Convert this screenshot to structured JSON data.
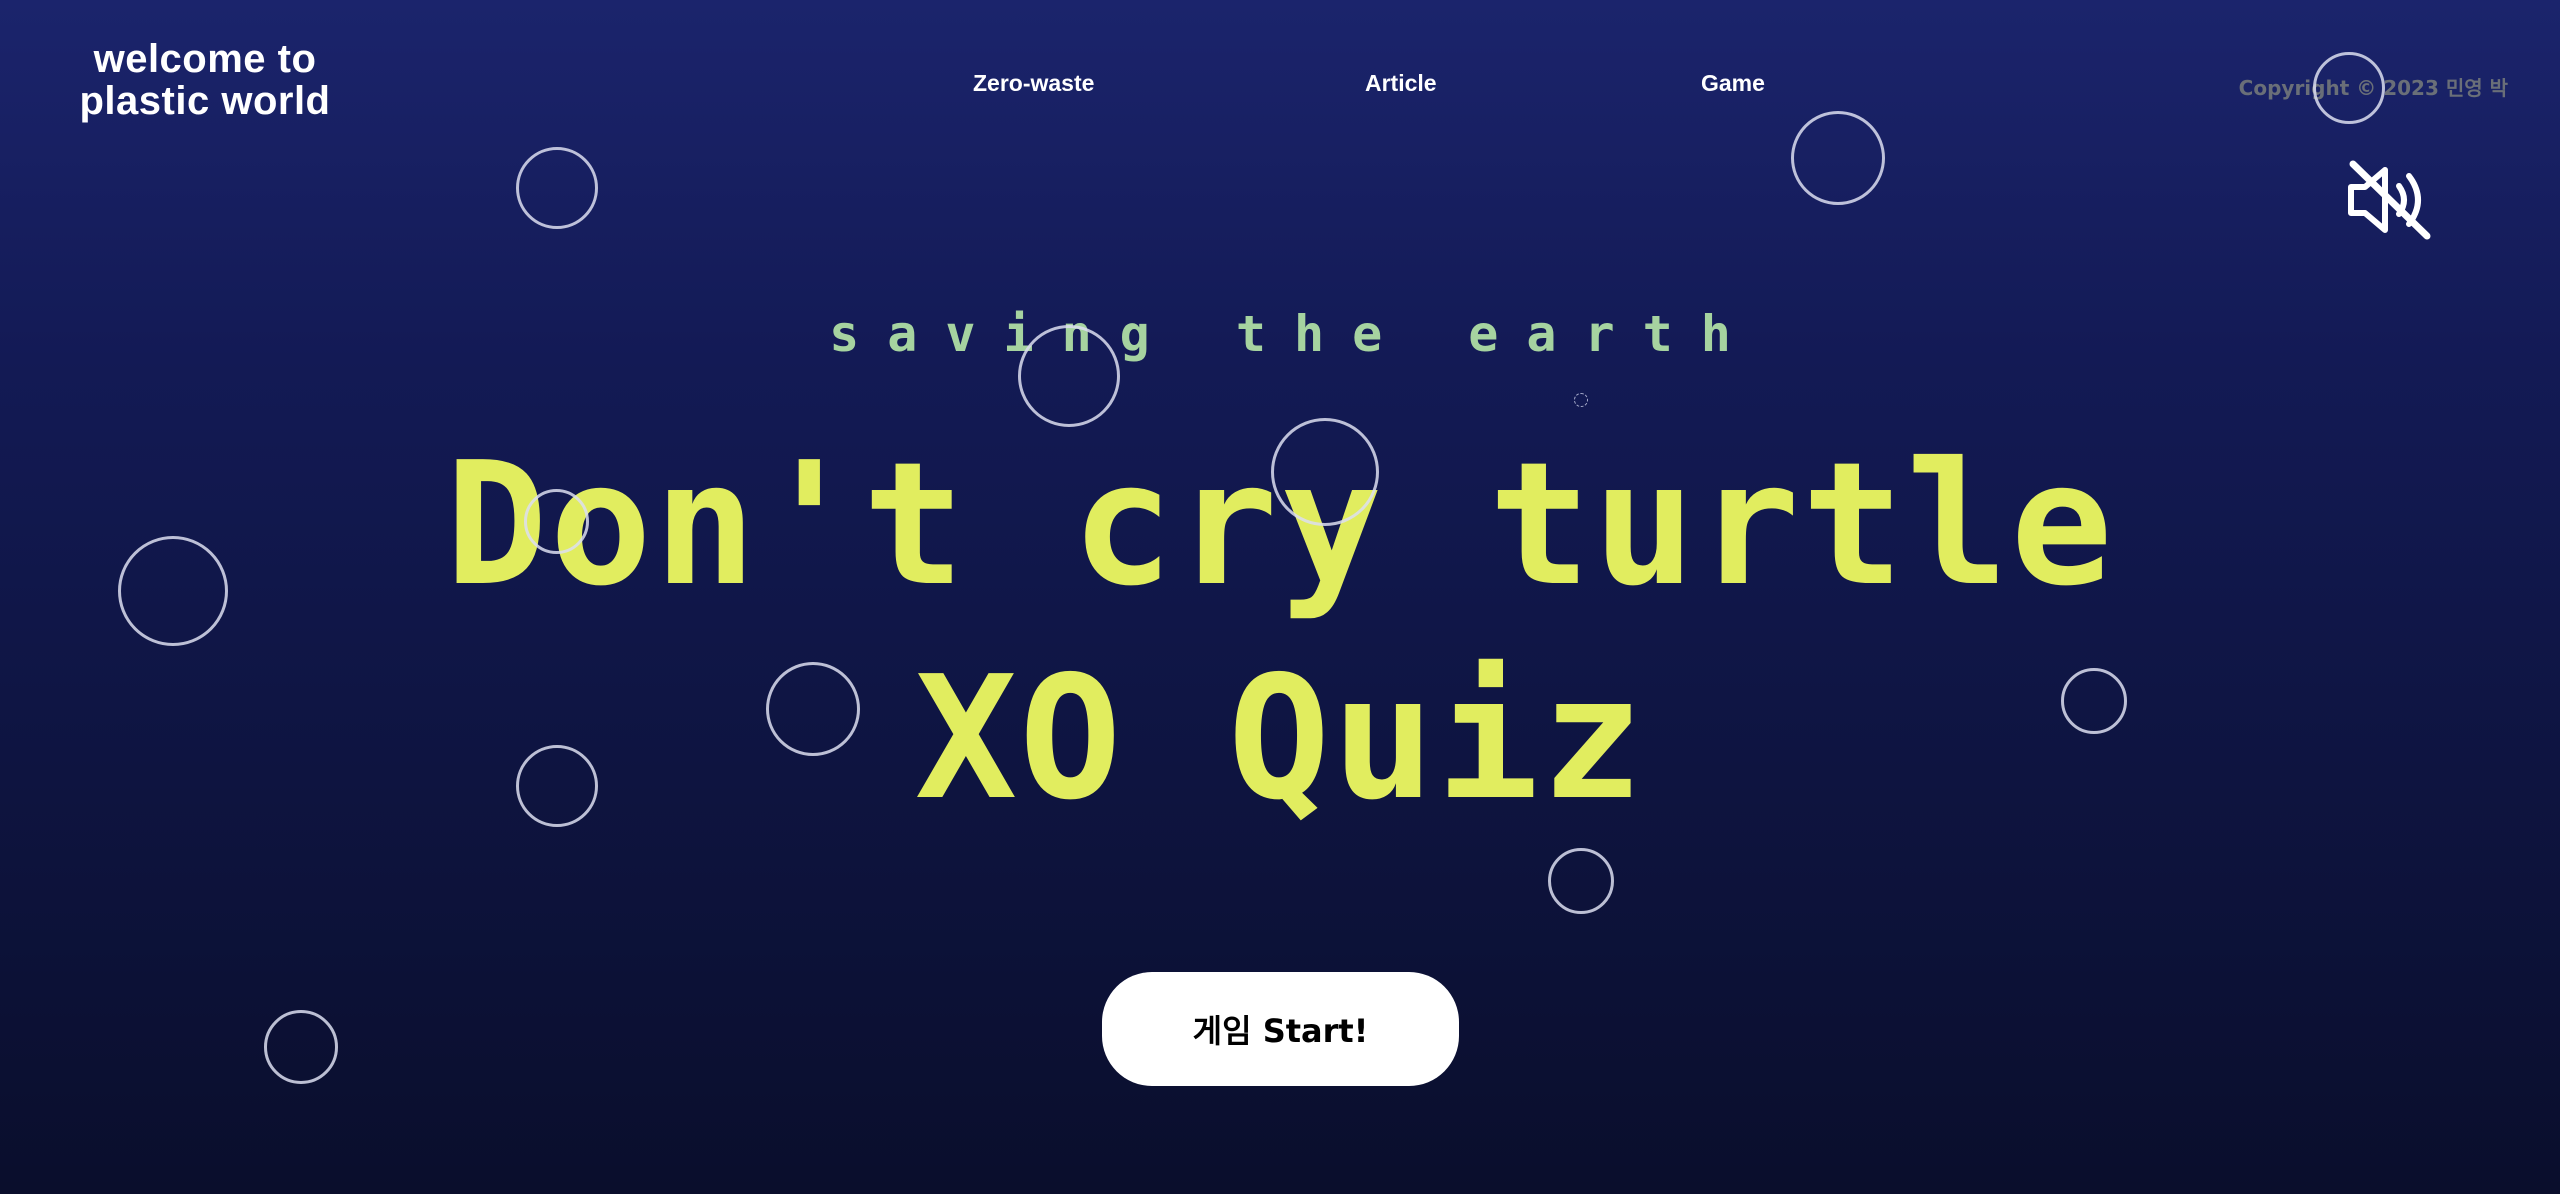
{
  "header": {
    "logo_line1": "welcome to",
    "logo_line2": "plastic world",
    "nav": [
      {
        "label": "Zero-waste"
      },
      {
        "label": "Article"
      },
      {
        "label": "Game"
      }
    ],
    "copyright": "Copyright © 2023 민영 박",
    "mute_icon": "speaker-muted-icon"
  },
  "hero": {
    "subtitle": "saving the earth",
    "title_line1": "Don't cry turtle",
    "title_line2": "XO Quiz",
    "start_button": "게임 Start!"
  },
  "colors": {
    "background_top": "#1b246c",
    "background_bottom": "#0a0e2c",
    "title": "#e1ed5f",
    "subtitle": "#a6d3a0",
    "button_bg": "#ffffff",
    "copyright": "#6a6f78"
  },
  "decorations": {
    "bubble_icon": "bubble-circle"
  }
}
